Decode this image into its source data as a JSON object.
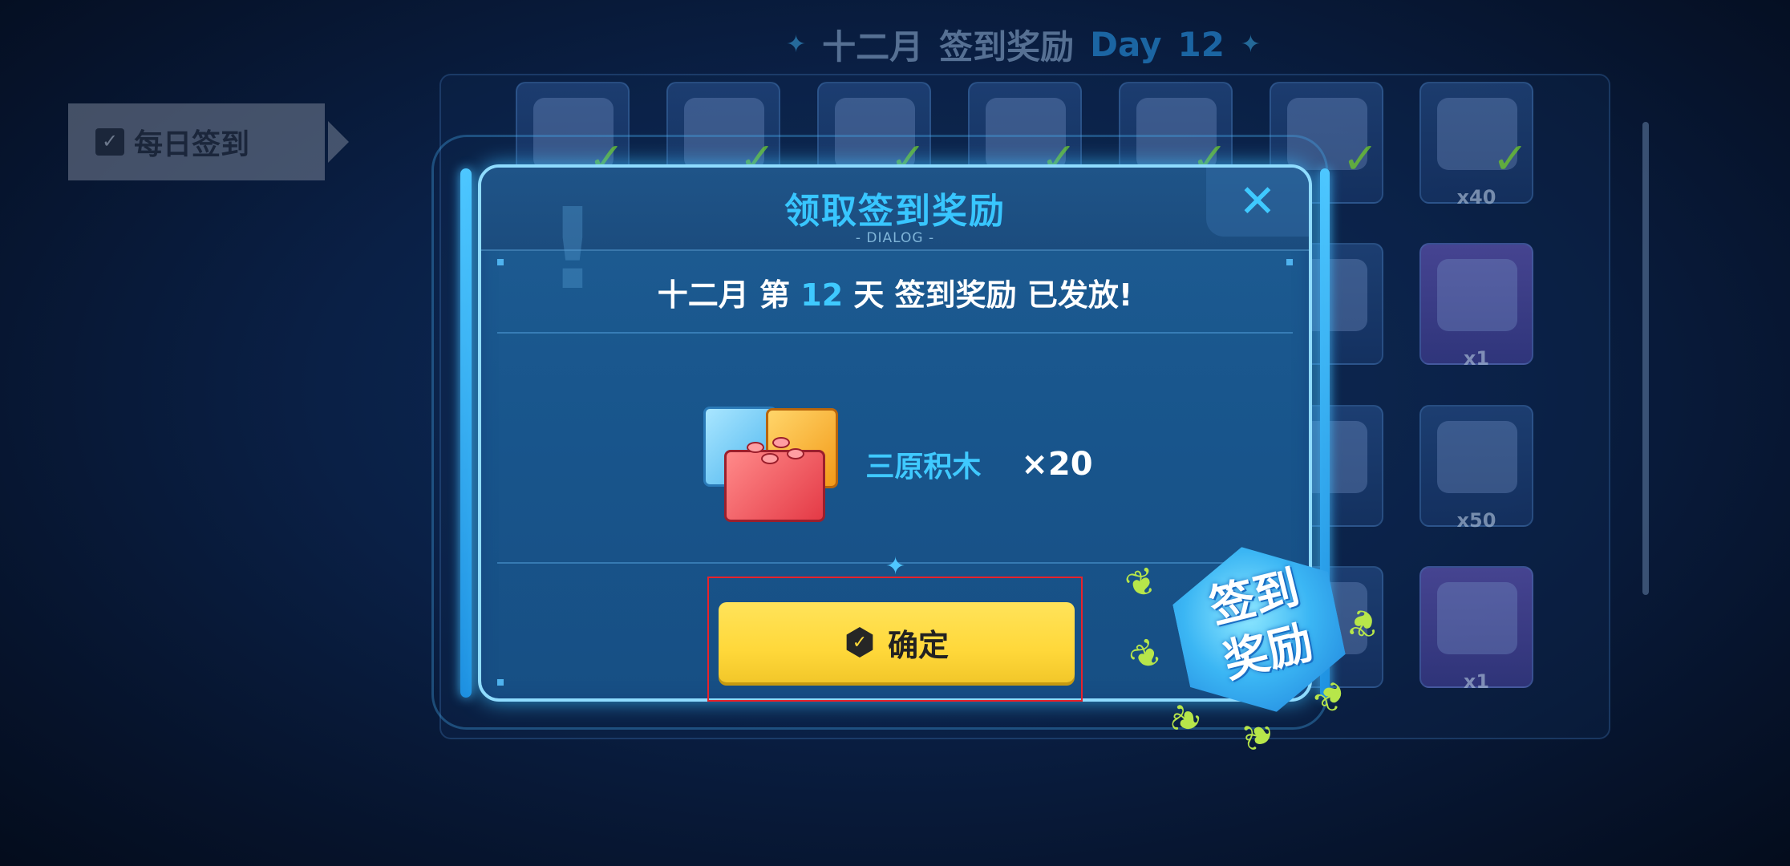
{
  "background": {
    "header": {
      "month": "十二月",
      "title": "签到奖励",
      "day_label": "Day",
      "day_number": "12"
    },
    "side_tab": {
      "label": "每日签到"
    },
    "tile_quantities": [
      "x40",
      "x1",
      "x50",
      "x1"
    ]
  },
  "dialog": {
    "title": "领取签到奖励",
    "subtitle": "- DIALOG -",
    "close_symbol": "✕",
    "message_parts": {
      "month": "十二月",
      "di": "第",
      "day": "12",
      "tian": "天",
      "reward": "签到奖励",
      "issued": "已发放!"
    },
    "reward": {
      "icon": "building-blocks-icon",
      "name": "三原积木",
      "quantity": "×20"
    },
    "confirm_button": {
      "label": "确定",
      "icon": "check-hexagon-icon"
    }
  },
  "badge": {
    "line1": "签到",
    "line2": "奖励"
  },
  "colors": {
    "accent_blue": "#3fc9ff",
    "confirm_yellow": "#ffd83a",
    "highlight_box": "#e8222b",
    "laurel_green": "#b7e64a"
  }
}
